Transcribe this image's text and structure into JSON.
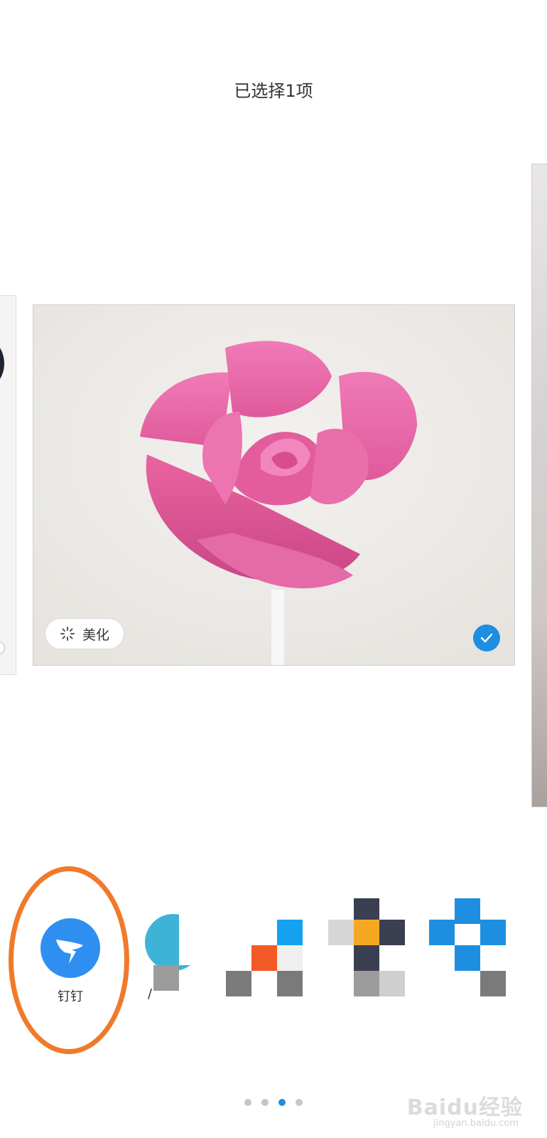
{
  "header": {
    "title": "已选择1项"
  },
  "photo": {
    "beautify_label": "美化",
    "selected": true
  },
  "share": {
    "items": [
      {
        "label": "钉钉",
        "icon": "dingtalk-icon"
      },
      {
        "label": "/",
        "icon": "app-icon-blurred"
      },
      {
        "label": "",
        "icon": "app-icon-blurred"
      },
      {
        "label": "",
        "icon": "app-icon-blurred"
      },
      {
        "label": "",
        "icon": "app-icon-blurred"
      }
    ]
  },
  "pagination": {
    "total": 4,
    "active": 3
  },
  "watermark": {
    "text": "Baidu经验",
    "sub": "jingyan.baidu.com"
  },
  "colors": {
    "accent": "#1e8fe0",
    "highlight": "#f07a2a",
    "dingtalk": "#2f8ff0"
  }
}
